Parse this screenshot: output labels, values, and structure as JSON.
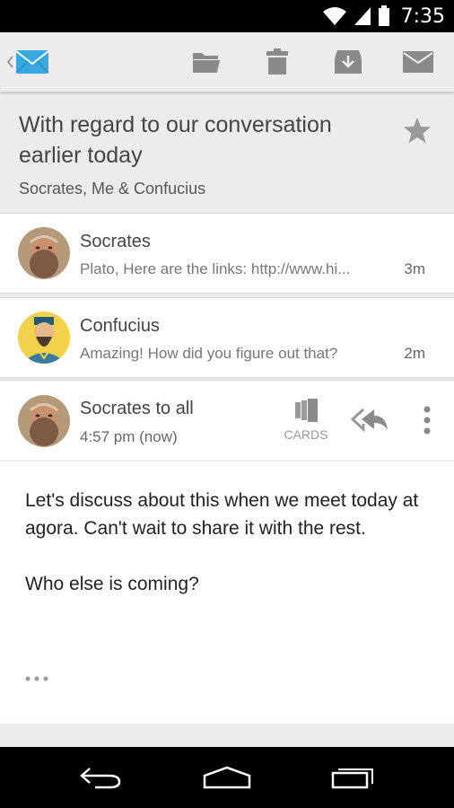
{
  "status_bar": {
    "time": "7:35",
    "icons": [
      "wifi-icon",
      "signal-icon",
      "battery-icon"
    ]
  },
  "action_bar": {
    "back_icon": "back-chevron-icon",
    "app_icon": "mail-app-icon",
    "actions": [
      "move-folder-icon",
      "delete-icon",
      "archive-icon",
      "mark-unread-icon"
    ]
  },
  "conversation": {
    "subject": "With regard to our conversation earlier today",
    "participants": "Socrates, Me & Confucius",
    "starred": false
  },
  "messages": [
    {
      "sender": "Socrates",
      "snippet": "Plato, Here are the links: http://www.hi...",
      "time": "3m"
    },
    {
      "sender": "Confucius",
      "snippet": "Amazing! How did you figure out that?",
      "time": "2m"
    }
  ],
  "expanded_message": {
    "sender": "Socrates to all",
    "timestamp": "4:57 pm (now)",
    "cards_label": "CARDS",
    "body": [
      "Let's discuss about this when we meet today at agora. Can't wait to share it with the rest.",
      "Who else is coming?"
    ],
    "more": "..."
  },
  "colors": {
    "accent_blue": "#3aa8e0",
    "star_gray": "#9a9a9a",
    "icon_gray": "#8a8a8a"
  }
}
